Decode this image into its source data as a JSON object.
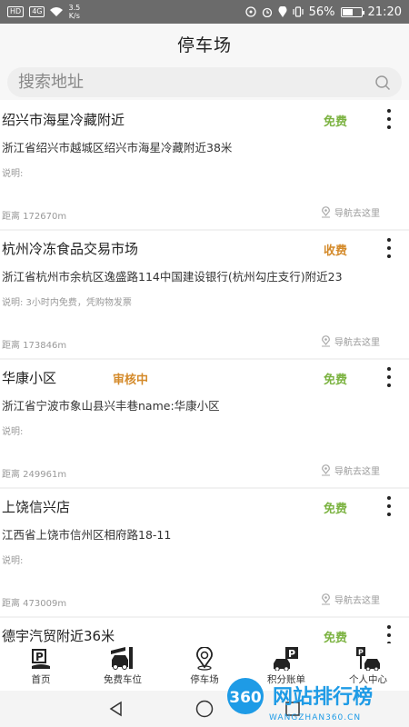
{
  "status_bar": {
    "network_badges": [
      "HD",
      "4G"
    ],
    "speed_value": "3.5",
    "speed_unit": "K/s",
    "battery_percent": "56%",
    "battery_level": 0.56,
    "time": "21:20"
  },
  "header": {
    "title": "停车场"
  },
  "search": {
    "placeholder": "搜索地址"
  },
  "parking_list": [
    {
      "name": "绍兴市海星冷藏附近",
      "review_status": "",
      "fee": "免费",
      "fee_color": "#7cb342",
      "address": "浙江省绍兴市越城区绍兴市海星冷藏附近38米",
      "note": "说明:",
      "distance": "距离  172670m",
      "navigate_label": "导航去这里"
    },
    {
      "name": "杭州冷冻食品交易市场",
      "review_status": "",
      "fee": "收费",
      "fee_color": "#d48a2a",
      "address": "浙江省杭州市余杭区逸盛路114中国建设银行(杭州勾庄支行)附近23",
      "note": "说明: 3小时内免费，凭购物发票",
      "distance": "距离  173846m",
      "navigate_label": "导航去这里"
    },
    {
      "name": "华康小区",
      "review_status": "审核中",
      "fee": "免费",
      "fee_color": "#7cb342",
      "address": "浙江省宁波市象山县兴丰巷name:华康小区",
      "note": "说明:",
      "distance": "距离  249961m",
      "navigate_label": "导航去这里"
    },
    {
      "name": "上饶信兴店",
      "review_status": "",
      "fee": "免费",
      "fee_color": "#7cb342",
      "address": "江西省上饶市信州区相府路18-11",
      "note": "说明:",
      "distance": "距离  473009m",
      "navigate_label": "导航去这里"
    },
    {
      "name": "德宇汽贸附近36米",
      "review_status": "",
      "fee": "免费",
      "fee_color": "#7cb342",
      "address": "",
      "note": "",
      "distance": "",
      "navigate_label": ""
    }
  ],
  "review_status_color": "#d48a2a",
  "bottom_nav": [
    {
      "label": "首页",
      "icon": "parking-sign-icon"
    },
    {
      "label": "免费车位",
      "icon": "car-barrier-icon"
    },
    {
      "label": "停车场",
      "icon": "location-pin-icon",
      "active": true
    },
    {
      "label": "积分账单",
      "icon": "car-parking-icon"
    },
    {
      "label": "个人中心",
      "icon": "parking-garage-icon"
    }
  ],
  "active_color": "#7fe0d8",
  "watermark": {
    "number": "360",
    "text": "网站排行榜",
    "domain": "WANGZHAN360.CN"
  }
}
